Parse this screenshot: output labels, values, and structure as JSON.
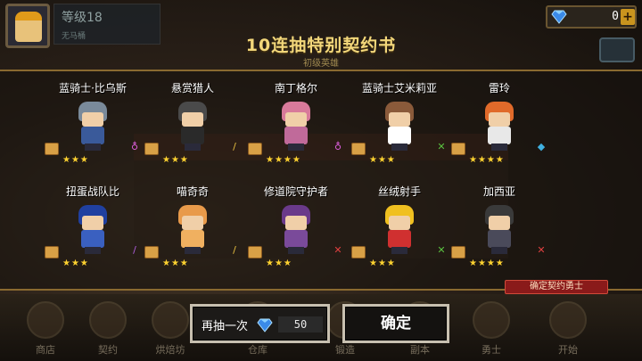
{
  "header": {
    "level": "等级18",
    "level_sub": "无马桶",
    "gems": "0",
    "gem_add": "+"
  },
  "title": "10连抽特别契约书",
  "subtitle": "初级英雄",
  "heroes": [
    {
      "name": "蓝骑士·比乌斯",
      "stars": "★★★",
      "hair": "#7a8a9a",
      "body": "#3a5a9a",
      "weapon": "♁",
      "weapon_color": "#e060e0"
    },
    {
      "name": "悬赏猎人",
      "stars": "★★★",
      "hair": "#4a4a4a",
      "body": "#2a2a2a",
      "weapon": "/",
      "weapon_color": "#e8c040"
    },
    {
      "name": "南丁格尔",
      "stars": "★★★★",
      "hair": "#d87a9a",
      "body": "#c06a9a",
      "weapon": "♁",
      "weapon_color": "#e060e0"
    },
    {
      "name": "蓝骑士艾米莉亚",
      "stars": "★★★",
      "hair": "#8a5a3a",
      "body": "#ffffff",
      "weapon": "✕",
      "weapon_color": "#5ac040"
    },
    {
      "name": "雷玲",
      "stars": "★★★★",
      "hair": "#e06a2a",
      "body": "#e8e8e8",
      "weapon": "◆",
      "weapon_color": "#40b0e0"
    },
    {
      "name": "扭蛋战队比",
      "stars": "★★★",
      "hair": "#2040a0",
      "body": "#3a60c0",
      "weapon": "/",
      "weapon_color": "#b060e0"
    },
    {
      "name": "喵奇奇",
      "stars": "★★★",
      "hair": "#e89a4a",
      "body": "#f0b060",
      "weapon": "/",
      "weapon_color": "#e8c040"
    },
    {
      "name": "修道院守护者",
      "stars": "★★★",
      "hair": "#6a3a8a",
      "body": "#7a4a9a",
      "weapon": "✕",
      "weapon_color": "#e04040"
    },
    {
      "name": "丝绒射手",
      "stars": "★★★",
      "hair": "#f0c020",
      "body": "#d03030",
      "weapon": "✕",
      "weapon_color": "#5ac040"
    },
    {
      "name": "加西亚",
      "stars": "★★★★",
      "hair": "#3a3a3a",
      "body": "#4a4a5a",
      "weapon": "✕",
      "weapon_color": "#e04040"
    }
  ],
  "confirm_tag": "确定契约勇士",
  "actions": {
    "again_label": "再抽一次",
    "again_cost": "50",
    "confirm_label": "确定"
  },
  "nav": [
    {
      "label": "商店"
    },
    {
      "label": "契约"
    },
    {
      "label": "烘焙坊"
    },
    {
      "label": "仓库"
    },
    {
      "label": "锻造"
    },
    {
      "label": "副本"
    },
    {
      "label": "勇士"
    },
    {
      "label": "开始"
    }
  ]
}
